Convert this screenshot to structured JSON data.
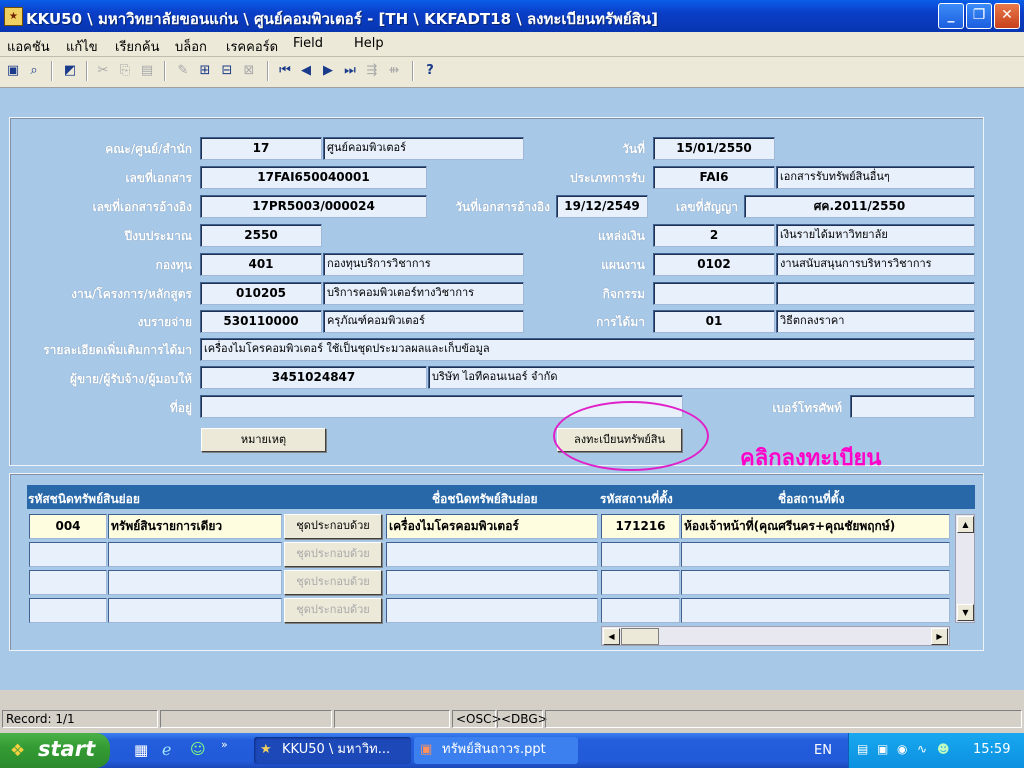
{
  "window": {
    "title": "KKU50 \\ มหาวิทยาลัยขอนแก่น \\ ศูนย์คอมพิวเตอร์ - [TH \\ KKFADT18 \\ ลงทะเบียนทรัพย์สิน]"
  },
  "menu": [
    "แอคชัน",
    "แก้ไข",
    "เรียกค้น",
    "บล็อก",
    "เรคคอร์ด",
    "Field",
    "Help"
  ],
  "form": {
    "faculty_label": "คณะ/ศูนย์/สำนัก",
    "faculty_code": "17",
    "faculty_name": "ศูนย์คอมพิวเตอร์",
    "date_label": "วันที่",
    "date": "15/01/2550",
    "doc_no_label": "เลขที่เอกสาร",
    "doc_no": "17FAI650040001",
    "receive_type_label": "ประเภทการรับ",
    "receive_type_code": "FAI6",
    "receive_type_name": "เอกสารรับทรัพย์สินอื่นๆ",
    "ref_doc_label": "เลขที่เอกสารอ้างอิง",
    "ref_doc": "17PR5003/000024",
    "ref_date_label": "วันที่เอกสารอ้างอิง",
    "ref_date": "19/12/2549",
    "contract_label": "เลขที่สัญญา",
    "contract": "ศค.2011/2550",
    "budget_year_label": "ปีงบประมาณ",
    "budget_year": "2550",
    "source_label": "แหล่งเงิน",
    "source_code": "2",
    "source_name": "เงินรายได้มหาวิทยาลัย",
    "fund_label": "กองทุน",
    "fund_code": "401",
    "fund_name": "กองทุนบริการวิชาการ",
    "plan_label": "แผนงาน",
    "plan_code": "0102",
    "plan_name": "งานสนับสนุนการบริหารวิชาการ",
    "project_label": "งาน/โครงการ/หลักสูตร",
    "project_code": "010205",
    "project_name": "บริการคอมพิวเตอร์ทางวิชาการ",
    "activity_label": "กิจกรรม",
    "activity_code": "",
    "activity_name": "",
    "expense_label": "งบรายจ่าย",
    "expense_code": "530110000",
    "expense_name": "ครุภัณฑ์คอมพิวเตอร์",
    "acquire_label": "การได้มา",
    "acquire_code": "01",
    "acquire_name": "วิธีตกลงราคา",
    "detail_label": "รายละเอียดเพิ่มเติมการได้มา",
    "detail": "เครื่องไมโครคอมพิวเตอร์ ใช้เป็นชุดประมวลผลและเก็บข้อมูล",
    "vendor_label": "ผู้ขาย/ผู้รับจ้าง/ผู้มอบให้",
    "vendor_code": "3451024847",
    "vendor_name": "บริษัท ไอทีคอนเนอร์ จำกัด",
    "address_label": "ที่อยู่",
    "address": "",
    "phone_label": "เบอร์โทรศัพท์",
    "phone": "",
    "note_button": "หมายเหตุ",
    "register_button": "ลงทะเบียนทรัพย์สิน",
    "hint": "คลิกลงทะเบียน"
  },
  "grid": {
    "headers": [
      "รหัสชนิดทรัพย์สินย่อย",
      "ชื่อชนิดทรัพย์สินย่อย",
      "รหัสสถานที่ตั้ง",
      "ชื่อสถานที่ตั้ง"
    ],
    "component_button": "ชุดประกอบด้วย",
    "rows": [
      {
        "code": "004",
        "type": "ทรัพย์สินรายการเดียว",
        "name": "เครื่องไมโครคอมพิวเตอร์",
        "loc_code": "171216",
        "loc_name": "ห้องเจ้าหน้าที่(คุณศรีนคร+คุณชัยพฤกษ์)"
      },
      {
        "code": "",
        "type": "",
        "name": "",
        "loc_code": "",
        "loc_name": ""
      },
      {
        "code": "",
        "type": "",
        "name": "",
        "loc_code": "",
        "loc_name": ""
      },
      {
        "code": "",
        "type": "",
        "name": "",
        "loc_code": "",
        "loc_name": ""
      }
    ]
  },
  "status": {
    "record": "Record: 1/1",
    "osc": "<OSC>",
    "dbg": "<DBG>"
  },
  "taskbar": {
    "start": "start",
    "tasks": [
      "KKU50 \\ มหาวิท...",
      "ทรัพย์สินถาวร.ppt"
    ],
    "lang": "EN",
    "clock": "15:59"
  }
}
